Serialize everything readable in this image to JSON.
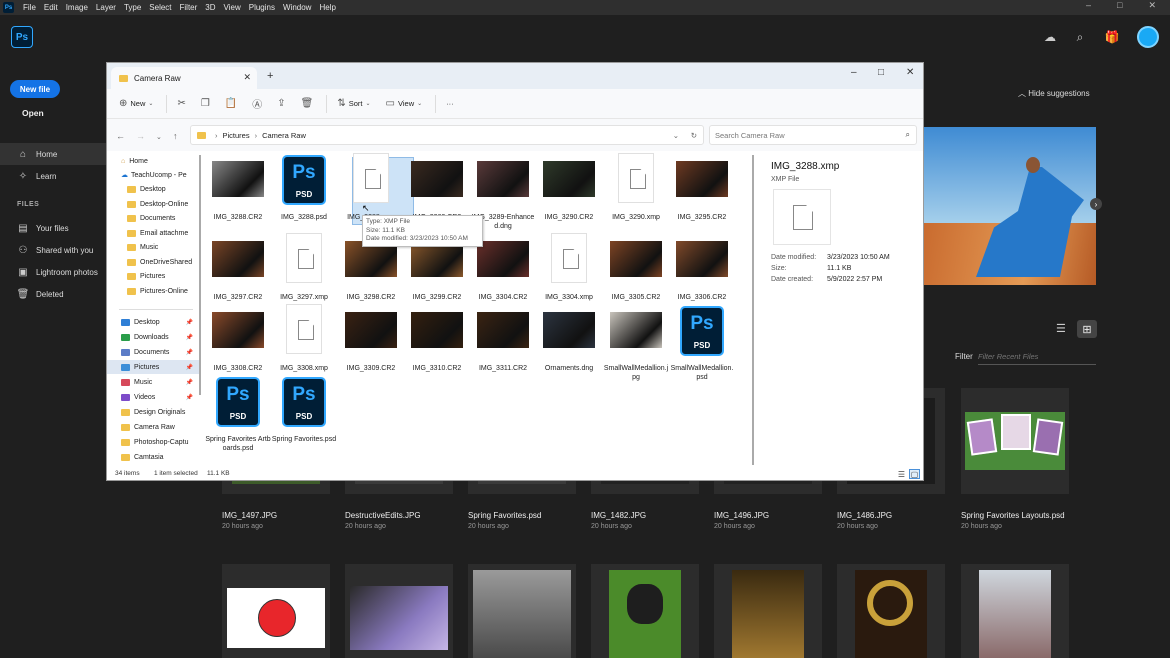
{
  "menu": {
    "logo": "Ps",
    "items": [
      "File",
      "Edit",
      "Image",
      "Layer",
      "Type",
      "Select",
      "Filter",
      "3D",
      "View",
      "Plugins",
      "Window",
      "Help"
    ],
    "minimize": "–",
    "maximize": "□",
    "close": "✕"
  },
  "app": {
    "logo": "Ps",
    "new_file": "New file",
    "open": "Open",
    "nav": [
      {
        "label": "Home",
        "icon": "home-icon"
      },
      {
        "label": "Learn",
        "icon": "learn-icon"
      }
    ],
    "files_header": "FILES",
    "files_nav": [
      {
        "label": "Your files",
        "icon": "file-icon"
      },
      {
        "label": "Shared with you",
        "icon": "shared-icon"
      },
      {
        "label": "Lightroom photos",
        "icon": "lightroom-icon"
      },
      {
        "label": "Deleted",
        "icon": "trash-icon"
      }
    ],
    "hide_suggestions": "Hide suggestions",
    "filter_label": "Filter",
    "filter_placeholder": "Filter Recent Files",
    "recent_row1": [
      {
        "name": "IMG_1497.JPG",
        "time": "20 hours ago"
      },
      {
        "name": "DestructiveEdits.JPG",
        "time": "20 hours ago"
      },
      {
        "name": "Spring Favorites.psd",
        "time": "20 hours ago"
      },
      {
        "name": "IMG_1482.JPG",
        "time": "20 hours ago"
      },
      {
        "name": "IMG_1496.JPG",
        "time": "20 hours ago"
      },
      {
        "name": "IMG_1486.JPG",
        "time": "20 hours ago"
      },
      {
        "name": "Spring Favorites Layouts.psd",
        "time": "20 hours ago"
      }
    ]
  },
  "explorer": {
    "tab_title": "Camera Raw",
    "new_tab": "+",
    "toolbar": {
      "new": "New",
      "sort": "Sort",
      "view": "View",
      "more": "···"
    },
    "breadcrumb": [
      "Pictures",
      "Camera Raw"
    ],
    "search_placeholder": "Search Camera Raw",
    "nav_tree": [
      {
        "label": "Home",
        "kind": "home"
      },
      {
        "label": "TeachUcomp - Pe",
        "kind": "cloud"
      },
      {
        "label": "Desktop",
        "kind": "folder"
      },
      {
        "label": "Desktop-Online",
        "kind": "folder"
      },
      {
        "label": "Documents",
        "kind": "folder"
      },
      {
        "label": "Email attachme",
        "kind": "folder"
      },
      {
        "label": "Music",
        "kind": "folder"
      },
      {
        "label": "OneDriveShared",
        "kind": "folder"
      },
      {
        "label": "Pictures",
        "kind": "folder"
      },
      {
        "label": "Pictures-Online",
        "kind": "folder"
      }
    ],
    "quick_access": [
      {
        "label": "Desktop",
        "color": "#2f7fd6"
      },
      {
        "label": "Downloads",
        "color": "#2a9d4a"
      },
      {
        "label": "Documents",
        "color": "#5b7cc7"
      },
      {
        "label": "Pictures",
        "color": "#3c8ed8"
      },
      {
        "label": "Music",
        "color": "#d6495a"
      },
      {
        "label": "Videos",
        "color": "#7d4cc9"
      },
      {
        "label": "Design Originals",
        "color": "#f0c24c"
      },
      {
        "label": "Camera Raw",
        "color": "#f0c24c"
      },
      {
        "label": "Photoshop-Captu",
        "color": "#f0c24c"
      },
      {
        "label": "Camtasia",
        "color": "#f0c24c"
      }
    ],
    "files": [
      {
        "name": "IMG_3288.CR2",
        "kind": "photo",
        "color": "#888888"
      },
      {
        "name": "IMG_3288.psd",
        "kind": "psd"
      },
      {
        "name": "IMG_3288.xmp",
        "kind": "doc",
        "selected": true
      },
      {
        "name": "IMG_3289.CR2",
        "kind": "photo",
        "color": "#3a2a20"
      },
      {
        "name": "IMG_3289-Enhanced.dng",
        "kind": "photo",
        "color": "#5a3a3a"
      },
      {
        "name": "IMG_3290.CR2",
        "kind": "photo",
        "color": "#2f3a2a"
      },
      {
        "name": "IMG_3290.xmp",
        "kind": "doc"
      },
      {
        "name": "IMG_3295.CR2",
        "kind": "photo",
        "color": "#6e3a22"
      },
      {
        "name": "IMG_3297.CR2",
        "kind": "photo",
        "color": "#7a4526"
      },
      {
        "name": "IMG_3297.xmp",
        "kind": "doc"
      },
      {
        "name": "IMG_3298.CR2",
        "kind": "photo",
        "color": "#8a5228"
      },
      {
        "name": "IMG_3299.CR2",
        "kind": "photo",
        "color": "#8d5a2c"
      },
      {
        "name": "IMG_3304.CR2",
        "kind": "photo",
        "color": "#6a2f2a"
      },
      {
        "name": "IMG_3304.xmp",
        "kind": "doc"
      },
      {
        "name": "IMG_3305.CR2",
        "kind": "photo",
        "color": "#7e4424"
      },
      {
        "name": "IMG_3306.CR2",
        "kind": "photo",
        "color": "#814a2a"
      },
      {
        "name": "IMG_3308.CR2",
        "kind": "photo",
        "color": "#8a4a2a"
      },
      {
        "name": "IMG_3308.xmp",
        "kind": "doc"
      },
      {
        "name": "IMG_3309.CR2",
        "kind": "photo",
        "color": "#3a2212"
      },
      {
        "name": "IMG_3310.CR2",
        "kind": "photo",
        "color": "#34200f"
      },
      {
        "name": "IMG_3311.CR2",
        "kind": "photo",
        "color": "#3b2412"
      },
      {
        "name": "Ornaments.dng",
        "kind": "photo",
        "color": "#2c3440"
      },
      {
        "name": "SmallWallMedallion.jpg",
        "kind": "photo",
        "color": "#c9c4bc"
      },
      {
        "name": "SmallWallMedallion.psd",
        "kind": "psd"
      },
      {
        "name": "Spring Favorites Artboards.psd",
        "kind": "psd"
      },
      {
        "name": "Spring Favorites.psd",
        "kind": "psd"
      }
    ],
    "psd_text": {
      "top": "Ps",
      "bottom": "PSD"
    },
    "tooltip": {
      "type": "Type: XMP File",
      "size": "Size: 11.1 KB",
      "modified": "Date modified: 3/23/2023 10:50 AM"
    },
    "details": {
      "name": "IMG_3288.xmp",
      "type": "XMP File",
      "modified_label": "Date modified:",
      "modified": "3/23/2023 10:50 AM",
      "size_label": "Size:",
      "size": "11.1 KB",
      "created_label": "Date created:",
      "created": "5/9/2022 2:57 PM"
    },
    "status": {
      "count": "34 items",
      "selected": "1 item selected",
      "size": "11.1 KB"
    }
  }
}
